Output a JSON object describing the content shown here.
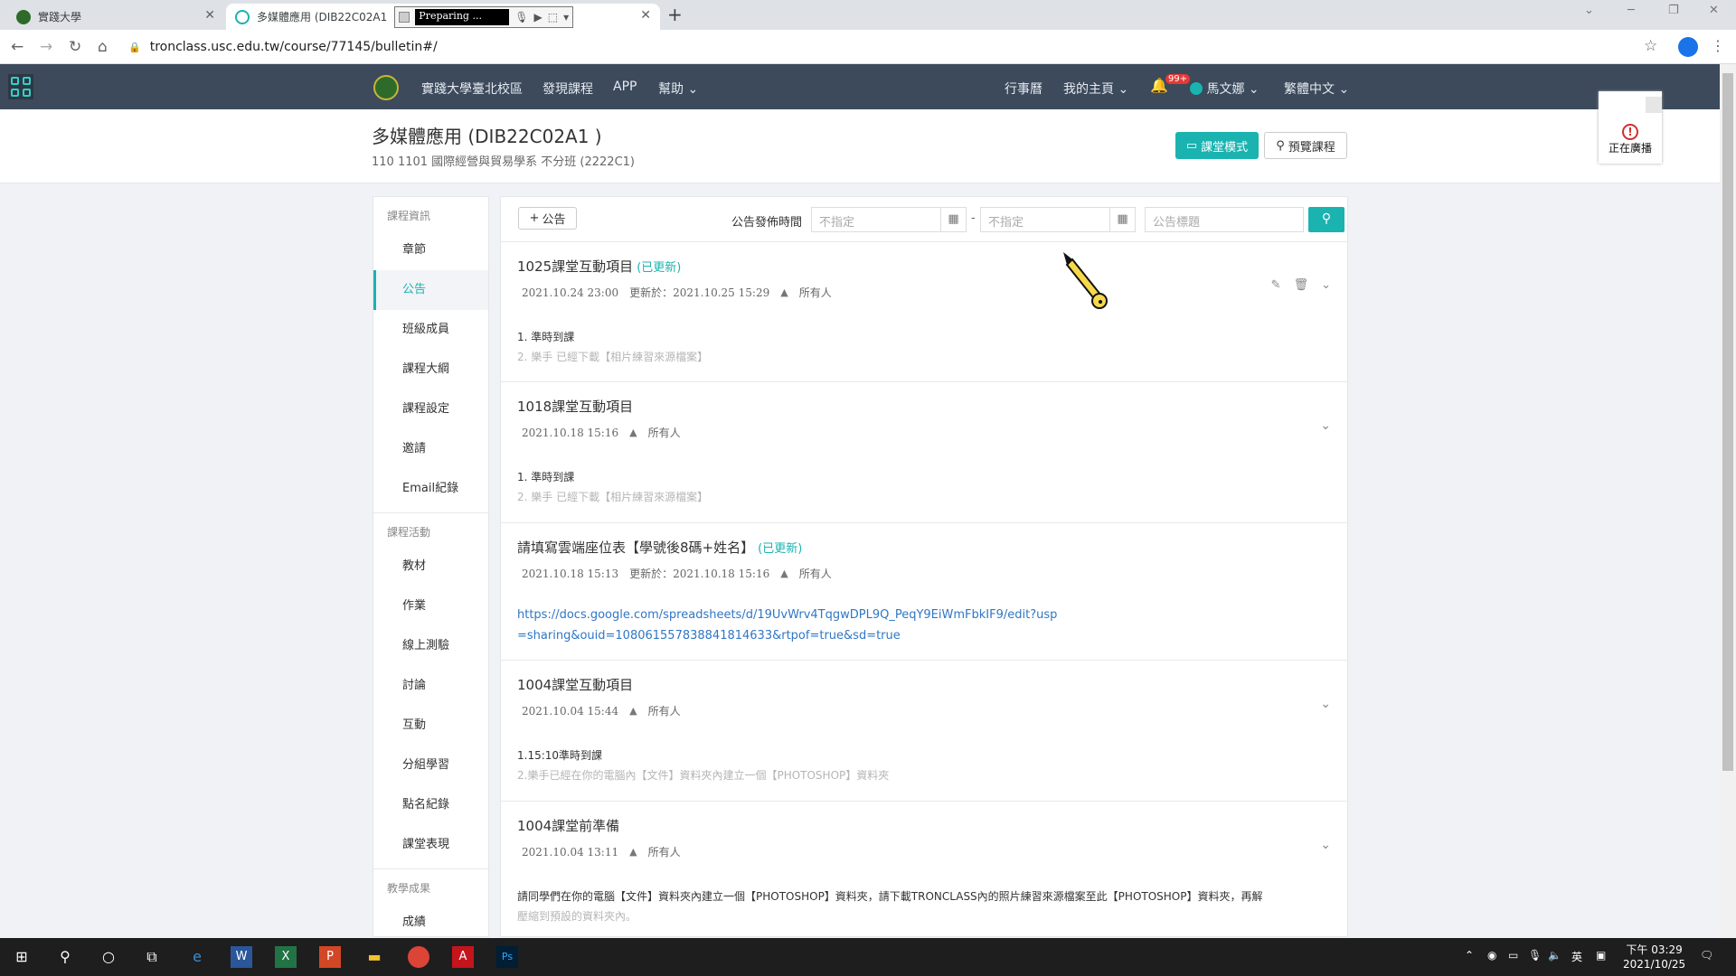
{
  "browser": {
    "tabs": [
      {
        "title": "實踐大學",
        "active": false
      },
      {
        "title": "多媒體應用 (DIB22C02A1",
        "active": true
      }
    ],
    "recorder_status": "Preparing ...",
    "url": "tronclass.usc.edu.tw/course/77145/bulletin#/"
  },
  "topnav": {
    "links": [
      "實踐大學臺北校區",
      "發現課程",
      "APP",
      "幫助"
    ],
    "right": {
      "calendar": "行事曆",
      "home": "我的主頁",
      "notif_badge": "99+",
      "user": "馬文娜",
      "language": "繁體中文"
    }
  },
  "course": {
    "title": "多媒體應用 (DIB22C02A1 )",
    "subtitle": "110 1101 國際經營與貿易學系 不分班 (2222C1)",
    "class_mode_label": "課堂模式",
    "preview_label": "預覽課程",
    "broadcast_label": "正在廣播"
  },
  "sidebar": {
    "groups": [
      {
        "title": "課程資訊",
        "items": [
          "章節",
          "公告",
          "班級成員",
          "課程大綱",
          "課程設定",
          "邀請",
          "Email紀錄"
        ]
      },
      {
        "title": "課程活動",
        "items": [
          "教材",
          "作業",
          "線上測驗",
          "討論",
          "互動",
          "分組學習",
          "點名紀錄",
          "課堂表現"
        ]
      },
      {
        "title": "教學成果",
        "items": [
          "成績"
        ]
      }
    ],
    "active": "公告"
  },
  "toolbar": {
    "add_label": "公告",
    "filter_label": "公告發佈時間",
    "date_from_placeholder": "不指定",
    "date_to_placeholder": "不指定",
    "title_placeholder": "公告標題"
  },
  "posts": [
    {
      "title": "1025課堂互動項目",
      "updated_tag": "(已更新)",
      "date": "2021.10.24 23:00",
      "updated": "更新於：2021.10.25 15:29",
      "audience": "所有人",
      "line1": "1. 準時到課",
      "line2": "2. 樂手 已經下載【相片練習來源檔案】"
    },
    {
      "title": "1018課堂互動項目",
      "updated_tag": "",
      "date": "2021.10.18 15:16",
      "updated": "",
      "audience": "所有人",
      "line1": "1. 準時到課",
      "line2": "2. 樂手 已經下載【相片練習來源檔案】"
    },
    {
      "title": "請填寫雲端座位表【學號後8碼+姓名】",
      "updated_tag": "(已更新)",
      "date": "2021.10.18 15:13",
      "updated": "更新於：2021.10.18 15:16",
      "audience": "所有人",
      "link": "https://docs.google.com/spreadsheets/d/19UvWrv4TqgwDPL9Q_PeqY9EiWmFbkIF9/edit?usp=sharing&ouid=108061557838841814633&rtpof=true&sd=true"
    },
    {
      "title": "1004課堂互動項目",
      "updated_tag": "",
      "date": "2021.10.04 15:44",
      "updated": "",
      "audience": "所有人",
      "line1": "1.15:10準時到課",
      "line2": "2.樂手已經在你的電腦內【文件】資料夾內建立一個【PHOTOSHOP】資料夾"
    },
    {
      "title": "1004課堂前準備",
      "updated_tag": "",
      "date": "2021.10.04 13:11",
      "updated": "",
      "audience": "所有人",
      "line1": "請同學們在你的電腦【文件】資料夾內建立一個【PHOTOSHOP】資料夾，請下載TRONCLASS內的照片練習來源檔案至此【PHOTOSHOP】資料夾，再解",
      "line2": "壓縮到預設的資料夾內。"
    }
  ],
  "taskbar": {
    "ime": "英",
    "time": "下午 03:29",
    "date": "2021/10/25"
  },
  "colors": {
    "accent": "#1ab3b0",
    "navbar": "#3c4a5c",
    "link": "#2f77c5"
  }
}
